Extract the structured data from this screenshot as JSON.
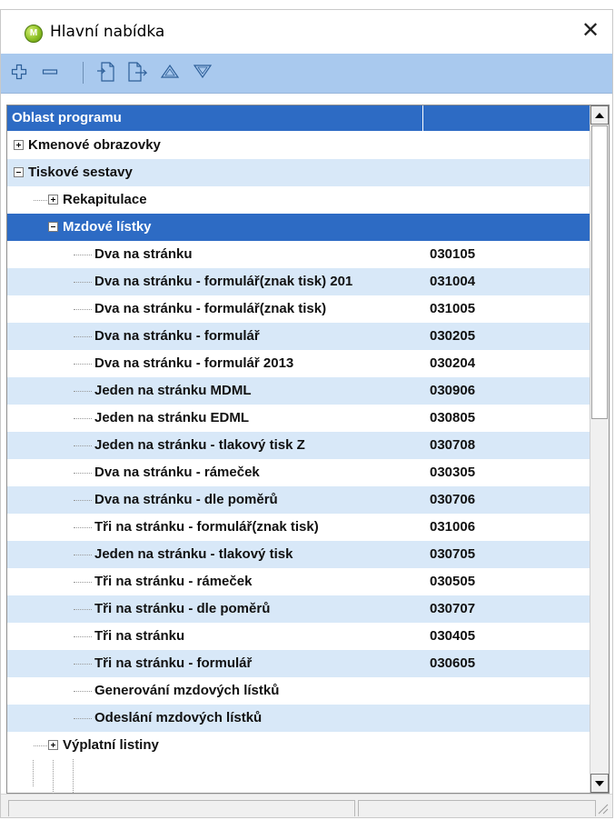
{
  "window": {
    "title": "Hlavní nabídka",
    "close_glyph": "✕",
    "app_icon_letter": "M"
  },
  "toolbar": {
    "buttons": [
      {
        "icon": "plus-icon"
      },
      {
        "icon": "minus-icon"
      },
      {
        "icon": "insert-before-icon"
      },
      {
        "icon": "insert-after-icon"
      },
      {
        "icon": "move-up-icon"
      },
      {
        "icon": "move-down-icon"
      }
    ]
  },
  "grid": {
    "header": {
      "col1": "Oblast programu",
      "col2": ""
    },
    "rows": [
      {
        "label": "Kmenové obrazovky",
        "code": "",
        "expander": "plus"
      },
      {
        "label": "Tiskové sestavy",
        "code": "",
        "expander": "minus"
      },
      {
        "label": "Rekapitulace",
        "code": "",
        "expander": "plus"
      },
      {
        "label": "Mzdové lístky",
        "code": "",
        "expander": "minus",
        "selected": true
      },
      {
        "label": "Dva na stránku",
        "code": "030105"
      },
      {
        "label": "Dva na stránku - formulář(znak tisk) 201",
        "code": "031004"
      },
      {
        "label": "Dva na stránku - formulář(znak tisk)",
        "code": "031005"
      },
      {
        "label": "Dva na stránku - formulář",
        "code": "030205"
      },
      {
        "label": "Dva na stránku - formulář 2013",
        "code": "030204"
      },
      {
        "label": "Jeden na stránku MDML",
        "code": "030906"
      },
      {
        "label": "Jeden na stránku EDML",
        "code": "030805"
      },
      {
        "label": "Jeden na stránku - tlakový tisk Z",
        "code": "030708"
      },
      {
        "label": "Dva na stránku - rámeček",
        "code": "030305"
      },
      {
        "label": "Dva na stránku - dle poměrů",
        "code": "030706"
      },
      {
        "label": "Tři na stránku - formulář(znak tisk)",
        "code": "031006"
      },
      {
        "label": "Jeden na stránku - tlakový tisk",
        "code": "030705"
      },
      {
        "label": "Tři na stránku - rámeček",
        "code": "030505"
      },
      {
        "label": "Tři na stránku - dle poměrů",
        "code": "030707"
      },
      {
        "label": "Tři na stránku",
        "code": "030405"
      },
      {
        "label": "Tři na stránku - formulář",
        "code": "030605"
      },
      {
        "label": "Generování mzdových lístků",
        "code": ""
      },
      {
        "label": "Odeslání mzdových lístků",
        "code": ""
      },
      {
        "label": "Výplatní listiny",
        "code": "",
        "expander": "plus"
      }
    ]
  },
  "scrollbar": {
    "up_icon": "scroll-up-arrow-icon",
    "down_icon": "scroll-down-arrow-icon"
  },
  "colors": {
    "toolbar_bg": "#a9c9ee",
    "header_bg": "#2d6bc4",
    "selection_bg": "#2d6bc4",
    "alt_row_bg": "#d8e8f8"
  }
}
